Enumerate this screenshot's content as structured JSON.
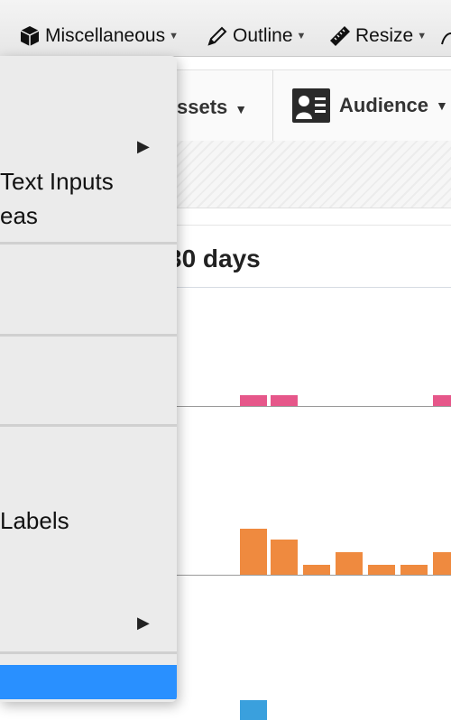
{
  "toolbar": {
    "items": [
      {
        "label": "Miscellaneous",
        "icon": "cube-icon"
      },
      {
        "label": "Outline",
        "icon": "pencil-icon"
      },
      {
        "label": "Resize",
        "icon": "ruler-icon"
      }
    ]
  },
  "nav": {
    "assets_label": "ssets",
    "audience_label": "Audience"
  },
  "report": {
    "period_title": "30 days"
  },
  "menu": {
    "items": [
      {
        "label": "Text Inputs"
      },
      {
        "label": "eas"
      },
      {
        "label": "Labels"
      }
    ]
  },
  "charts": {
    "pink": {
      "color": "#e6578a"
    },
    "orange": {
      "color": "#ef8a3f"
    },
    "blue": {
      "color": "#3aa0dd"
    }
  },
  "colors": {
    "menu_highlight": "#2990ff"
  }
}
